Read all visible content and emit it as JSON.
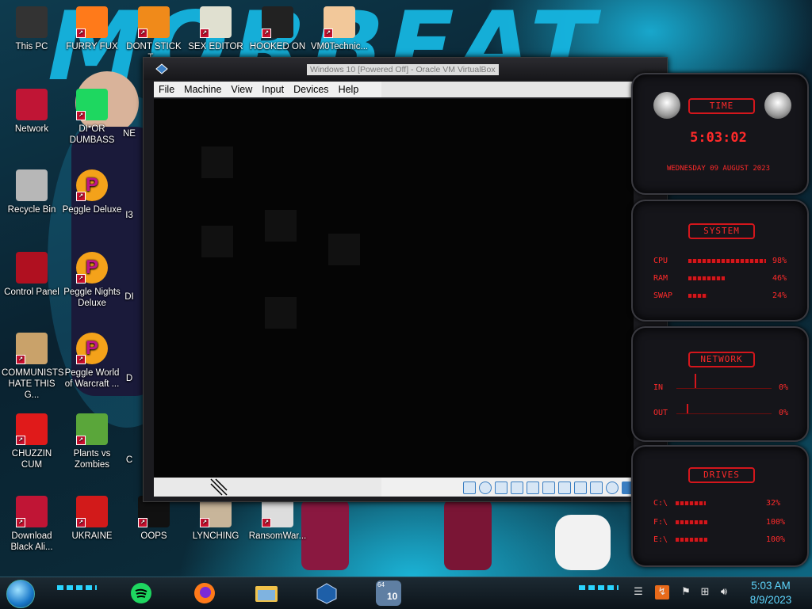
{
  "desktop": {
    "icons": [
      {
        "label": "This PC",
        "icon": "computer-icon"
      },
      {
        "label": "FURRY FUX",
        "icon": "firefox-icon"
      },
      {
        "label": "DONT STICK T...",
        "icon": "vlc-icon"
      },
      {
        "label": "SEX EDITOR",
        "icon": "hex-editor-icon"
      },
      {
        "label": "HOOKED ON",
        "icon": "app-icon"
      },
      {
        "label": "VM0Technic...",
        "icon": "doctor-icon"
      },
      {
        "label": "Network",
        "icon": "network-icon"
      },
      {
        "label": "DI*OR DUMBASS",
        "icon": "chat-icon"
      },
      {
        "label": "Recycle Bin",
        "icon": "recycle-bin-icon"
      },
      {
        "label": "Peggle Deluxe",
        "icon": "peggle-icon"
      },
      {
        "label": "Control Panel",
        "icon": "control-panel-icon"
      },
      {
        "label": "Peggle Nights Deluxe",
        "icon": "peggle-nights-icon"
      },
      {
        "label": "COMMUNISTS HATE THIS G...",
        "icon": "money-bag-icon"
      },
      {
        "label": "Peggle World of Warcraft ...",
        "icon": "peggle-wow-icon"
      },
      {
        "label": "CHUZZIN CUM",
        "icon": "chuzzle-icon"
      },
      {
        "label": "Plants vs Zombies",
        "icon": "pvz-icon"
      },
      {
        "label": "Download Black Ali...",
        "icon": "alien-icon"
      },
      {
        "label": "UKRAINE",
        "icon": "radiation-icon"
      },
      {
        "label": "OOPS",
        "icon": "terminal-icon"
      },
      {
        "label": "LYNCHING",
        "icon": "noose-icon"
      },
      {
        "label": "RansomWar...",
        "icon": "skull-icon"
      }
    ],
    "partial_labels": [
      "NE",
      "I3",
      "DI",
      "D",
      "C"
    ]
  },
  "vm_window": {
    "title": "Windows 10 [Powered Off] - Oracle VM VirtualBox",
    "menu": [
      "File",
      "Machine",
      "View",
      "Input",
      "Devices",
      "Help"
    ],
    "status_tail": "R"
  },
  "gadgets": {
    "time": {
      "header": "TIME",
      "clock": "5:03:02",
      "date": "WEDNESDAY 09 AUGUST 2023"
    },
    "system": {
      "header": "SYSTEM",
      "rows": [
        {
          "label": "CPU",
          "value": "98%",
          "level": 0.98
        },
        {
          "label": "RAM",
          "value": "46%",
          "level": 0.46
        },
        {
          "label": "SWAP",
          "value": "24%",
          "level": 0.24
        }
      ]
    },
    "network": {
      "header": "NETWORK",
      "rows": [
        {
          "label": "IN",
          "value": "0%"
        },
        {
          "label": "OUT",
          "value": "0%"
        }
      ]
    },
    "drives": {
      "header": "DRIVES",
      "rows": [
        {
          "label": "C:\\",
          "value": "32%",
          "level": 0.32
        },
        {
          "label": "F:\\",
          "value": "100%",
          "level": 1.0
        },
        {
          "label": "E:\\",
          "value": "100%",
          "level": 1.0
        }
      ]
    }
  },
  "taskbar": {
    "pinned": [
      "spotify-icon",
      "firefox-icon",
      "file-explorer-icon",
      "virtualbox-icon",
      "vm-windows10-icon"
    ],
    "vm_badge": "64",
    "vm_badge2": "10",
    "clock_time": "5:03 AM",
    "clock_date": "8/9/2023"
  },
  "colors": {
    "accent_red": "#d4161c",
    "accent_cyan": "#2ad4ff"
  }
}
